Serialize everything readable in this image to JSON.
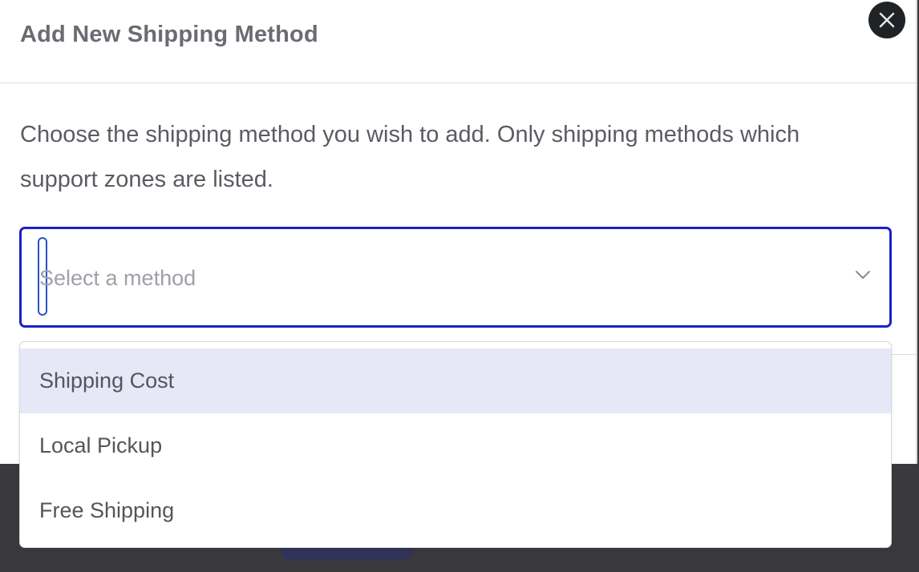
{
  "modal": {
    "title": "Add New Shipping Method",
    "description": "Choose the shipping method you wish to add. Only shipping methods which support zones are listed."
  },
  "select": {
    "placeholder": "Select a method",
    "border_color": "#1a20c9",
    "options": [
      {
        "label": "Shipping Cost",
        "highlighted": true
      },
      {
        "label": "Local Pickup",
        "highlighted": false
      },
      {
        "label": "Free Shipping",
        "highlighted": false
      }
    ]
  },
  "icons": {
    "close": "close-icon",
    "chevron": "chevron-down-icon"
  },
  "colors": {
    "highlight": "#e6e7f7",
    "close_button": "#1f2326",
    "overlay": "#3a3a3c"
  }
}
